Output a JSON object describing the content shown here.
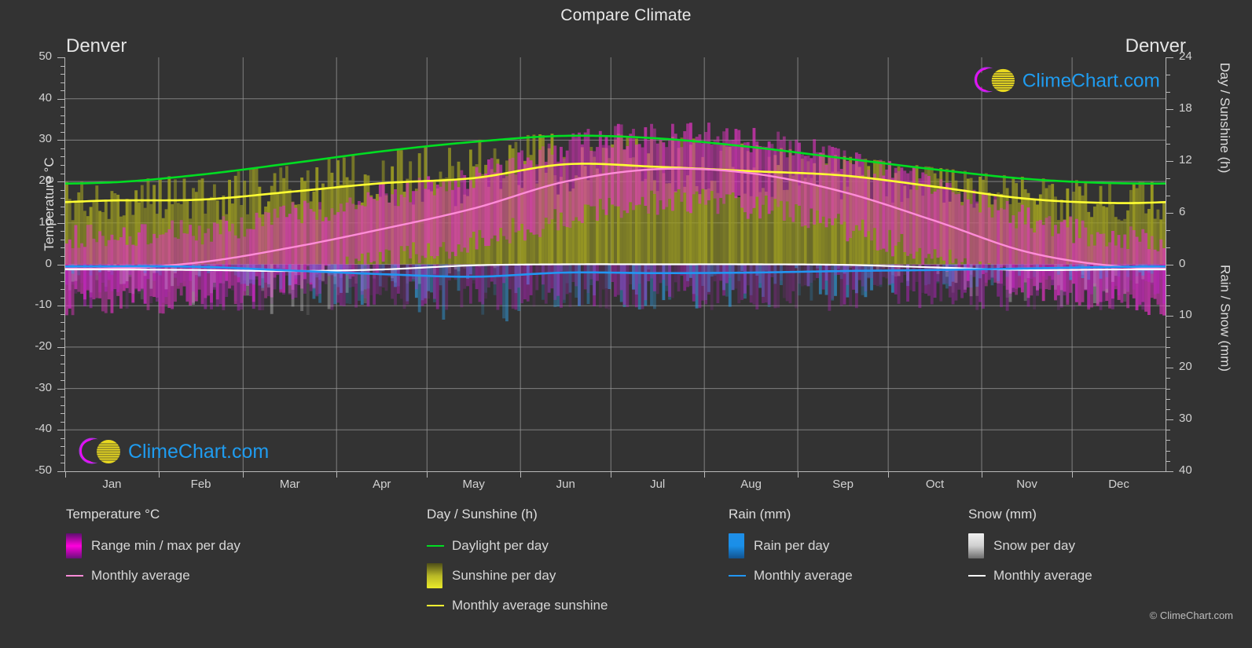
{
  "header": {
    "title": "Compare Climate",
    "location_left": "Denver",
    "location_right": "Denver"
  },
  "axes": {
    "left_title": "Temperature °C",
    "right_title_top": "Day / Sunshine (h)",
    "right_title_bottom": "Rain / Snow (mm)",
    "left_ticks": [
      "50",
      "40",
      "30",
      "20",
      "10",
      "0",
      "-10",
      "-20",
      "-30",
      "-40",
      "-50"
    ],
    "right_ticks_top": [
      "24",
      "18",
      "12",
      "6",
      "0"
    ],
    "right_ticks_bottom": [
      "10",
      "20",
      "30",
      "40"
    ],
    "months": [
      "Jan",
      "Feb",
      "Mar",
      "Apr",
      "May",
      "Jun",
      "Jul",
      "Aug",
      "Sep",
      "Oct",
      "Nov",
      "Dec"
    ]
  },
  "legend": {
    "temperature": {
      "heading": "Temperature °C",
      "range_label": "Range min / max per day",
      "average_label": "Monthly average",
      "range_color": "#ff00dd",
      "average_color": "#ff8cd8"
    },
    "sunshine": {
      "heading": "Day / Sunshine (h)",
      "daylight_label": "Daylight per day",
      "sunshine_label": "Sunshine per day",
      "average_label": "Monthly average sunshine",
      "daylight_color": "#00dd22",
      "sunshine_color": "#eaea2a",
      "average_color": "#ffff33"
    },
    "rain": {
      "heading": "Rain (mm)",
      "per_day_label": "Rain per day",
      "average_label": "Monthly average",
      "bar_color": "#1a8fe8",
      "average_color": "#2196f3"
    },
    "snow": {
      "heading": "Snow (mm)",
      "per_day_label": "Snow per day",
      "average_label": "Monthly average",
      "bar_color": "#ffffff",
      "average_color": "#ffffff"
    }
  },
  "watermark": {
    "text": "ClimeChart.com",
    "copyright": "© ClimeChart.com"
  },
  "chart_data": {
    "type": "area",
    "title": "Compare Climate",
    "subtitle": "Denver",
    "xlabel": "",
    "ylabel": "Temperature °C",
    "ylabel_right_top": "Day / Sunshine (h)",
    "ylabel_right_bottom": "Rain / Snow (mm)",
    "ylim": [
      -50,
      50
    ],
    "ylim_right_top": [
      0,
      24
    ],
    "ylim_right_bottom": [
      40,
      0
    ],
    "grid": true,
    "legend_position": "below",
    "categories": [
      "Jan",
      "Feb",
      "Mar",
      "Apr",
      "May",
      "Jun",
      "Jul",
      "Aug",
      "Sep",
      "Oct",
      "Nov",
      "Dec"
    ],
    "series": [
      {
        "name": "Daylight per day",
        "unit": "h",
        "axis": "right_top",
        "color": "#00dd22",
        "values": [
          9.5,
          10.4,
          11.7,
          13.1,
          14.2,
          14.9,
          14.6,
          13.6,
          12.3,
          11.0,
          9.9,
          9.4
        ]
      },
      {
        "name": "Monthly average sunshine",
        "unit": "h",
        "axis": "right_top",
        "color": "#ffff33",
        "values": [
          7.4,
          7.5,
          8.4,
          9.4,
          10.0,
          11.6,
          11.3,
          10.8,
          10.3,
          9.0,
          7.6,
          7.1
        ]
      },
      {
        "name": "Temperature monthly average",
        "unit": "°C",
        "axis": "left",
        "color": "#ff8cd8",
        "values": [
          -1.0,
          0.5,
          4.0,
          8.5,
          13.5,
          20.0,
          23.0,
          22.0,
          17.5,
          10.5,
          3.0,
          -0.5
        ]
      },
      {
        "name": "Temperature daily max (typical)",
        "unit": "°C",
        "axis": "left",
        "color": "#ff00dd",
        "values": [
          7.0,
          8.0,
          12.0,
          16.5,
          21.5,
          28.5,
          31.5,
          30.0,
          25.5,
          18.5,
          11.0,
          6.5
        ]
      },
      {
        "name": "Temperature daily min (typical)",
        "unit": "°C",
        "axis": "left",
        "color": "#ff00dd",
        "values": [
          -9.0,
          -8.0,
          -4.0,
          0.5,
          6.0,
          11.0,
          15.0,
          14.0,
          9.0,
          1.5,
          -5.0,
          -9.0
        ]
      },
      {
        "name": "Rain monthly average",
        "unit": "mm",
        "axis": "right_bottom",
        "color": "#2196f3",
        "values": [
          0.4,
          0.5,
          1.2,
          1.9,
          2.4,
          1.6,
          1.7,
          1.6,
          1.3,
          1.1,
          0.8,
          0.5
        ]
      },
      {
        "name": "Snow monthly average",
        "unit": "mm",
        "axis": "right_bottom",
        "color": "#ffffff",
        "values": [
          1.0,
          1.1,
          1.3,
          1.0,
          0.2,
          0.0,
          0.0,
          0.0,
          0.1,
          0.6,
          1.1,
          1.0
        ]
      }
    ]
  }
}
